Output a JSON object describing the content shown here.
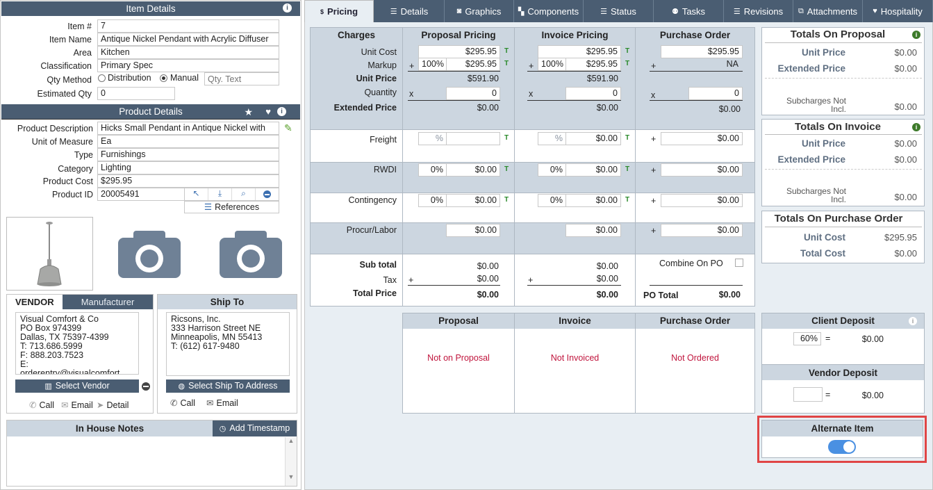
{
  "item_details": {
    "title": "Item Details",
    "item_no_label": "Item #",
    "item_no": "7",
    "item_name_label": "Item Name",
    "item_name": "Antique Nickel Pendant with Acrylic Diffuser",
    "area_label": "Area",
    "area": "Kitchen",
    "classification_label": "Classification",
    "classification": "Primary Spec",
    "qty_method_label": "Qty Method",
    "qty_distribution": "Distribution",
    "qty_manual": "Manual",
    "qty_text_placeholder": "Qty. Text",
    "est_qty_label": "Estimated Qty",
    "est_qty": "0"
  },
  "product_details": {
    "title": "Product Details",
    "desc_label": "Product Description",
    "desc": "Hicks Small Pendant in Antique Nickel with",
    "uom_label": "Unit of Measure",
    "uom": "Ea",
    "type_label": "Type",
    "type": "Furnishings",
    "category_label": "Category",
    "category": "Lighting",
    "cost_label": "Product Cost",
    "cost": "$295.95",
    "id_label": "Product ID",
    "id": "20005491",
    "references": "References"
  },
  "vendor": {
    "tab_vendor": "VENDOR",
    "tab_manufacturer": "Manufacturer",
    "address": "Visual Comfort & Co\nPO Box 974399\nDallas, TX 75397-4399\nT: 713.686.5999\nF: 888.203.7523\nE:\norderentry@visualcomfort",
    "select_btn": "Select Vendor",
    "call": "Call",
    "email": "Email",
    "detail": "Detail"
  },
  "ship_to": {
    "title": "Ship To",
    "address": "Ricsons, Inc.\n333 Harrison Street NE\nMinneapolis, MN 55413\nT: (612) 617-9480",
    "select_btn": "Select Ship To Address",
    "call": "Call",
    "email": "Email"
  },
  "notes": {
    "title": "In House Notes",
    "timestamp_btn": "Add Timestamp"
  },
  "tabs": [
    "Pricing",
    "Details",
    "Graphics",
    "Components",
    "Status",
    "Tasks",
    "Revisions",
    "Attachments",
    "Hospitality"
  ],
  "pricing": {
    "col_charges": "Charges",
    "col_proposal": "Proposal Pricing",
    "col_invoice": "Invoice Pricing",
    "col_po": "Purchase Order",
    "unit_cost_label": "Unit Cost",
    "markup_label": "Markup",
    "unit_price_label": "Unit Price",
    "quantity_label": "Quantity",
    "ext_price_label": "Extended Price",
    "prop_unit_cost": "$295.95",
    "prop_markup_pct": "100%",
    "prop_markup_val": "$295.95",
    "prop_unit_price": "$591.90",
    "prop_qty": "0",
    "prop_ext": "$0.00",
    "inv_unit_cost": "$295.95",
    "inv_markup_pct": "100%",
    "inv_markup_val": "$295.95",
    "inv_unit_price": "$591.90",
    "inv_qty": "0",
    "inv_ext": "$0.00",
    "po_unit_cost": "$295.95",
    "po_markup": "NA",
    "po_qty": "0",
    "po_ext": "$0.00",
    "freight_label": "Freight",
    "rwdi_label": "RWDI",
    "contingency_label": "Contingency",
    "procur_label": "Procur/Labor",
    "pct_placeholder": "%",
    "zero_pct": "0%",
    "zero": "$0.00",
    "subtotal_label": "Sub total",
    "tax_label": "Tax",
    "total_label": "Total Price",
    "combine_po": "Combine On PO",
    "po_total_label": "PO Total",
    "prop_sub": "$0.00",
    "prop_tax": "$0.00",
    "prop_total": "$0.00",
    "inv_sub": "$0.00",
    "inv_tax": "$0.00",
    "inv_total": "$0.00",
    "po_total": "$0.00",
    "t": "T",
    "plus": "+",
    "times": "x"
  },
  "status": {
    "proposal_title": "Proposal",
    "invoice_title": "Invoice",
    "po_title": "Purchase Order",
    "proposal": "Not on Proposal",
    "invoice": "Not Invoiced",
    "po": "Not Ordered"
  },
  "totals_proposal": {
    "title": "Totals On Proposal",
    "unit_price_label": "Unit Price",
    "unit_price": "$0.00",
    "ext_label": "Extended Price",
    "ext": "$0.00",
    "sub_label": "Subcharges Not Incl.",
    "sub": "$0.00"
  },
  "totals_invoice": {
    "title": "Totals On Invoice",
    "unit_price_label": "Unit Price",
    "unit_price": "$0.00",
    "ext_label": "Extended Price",
    "ext": "$0.00",
    "sub_label": "Subcharges Not Incl.",
    "sub": "$0.00"
  },
  "totals_po": {
    "title": "Totals On Purchase Order",
    "unit_cost_label": "Unit Cost",
    "unit_cost": "$295.95",
    "total_cost_label": "Total Cost",
    "total_cost": "$0.00"
  },
  "client_deposit": {
    "title": "Client Deposit",
    "pct": "60%",
    "eq": "=",
    "amount": "$0.00"
  },
  "vendor_deposit": {
    "title": "Vendor Deposit",
    "eq": "=",
    "amount": "$0.00"
  },
  "alternate": {
    "title": "Alternate Item",
    "enabled": true
  },
  "colors": {
    "dark_header": "#4a5d72",
    "light_header": "#ccd6e0",
    "highlight": "#e04545",
    "toggle": "#4a90e2"
  }
}
